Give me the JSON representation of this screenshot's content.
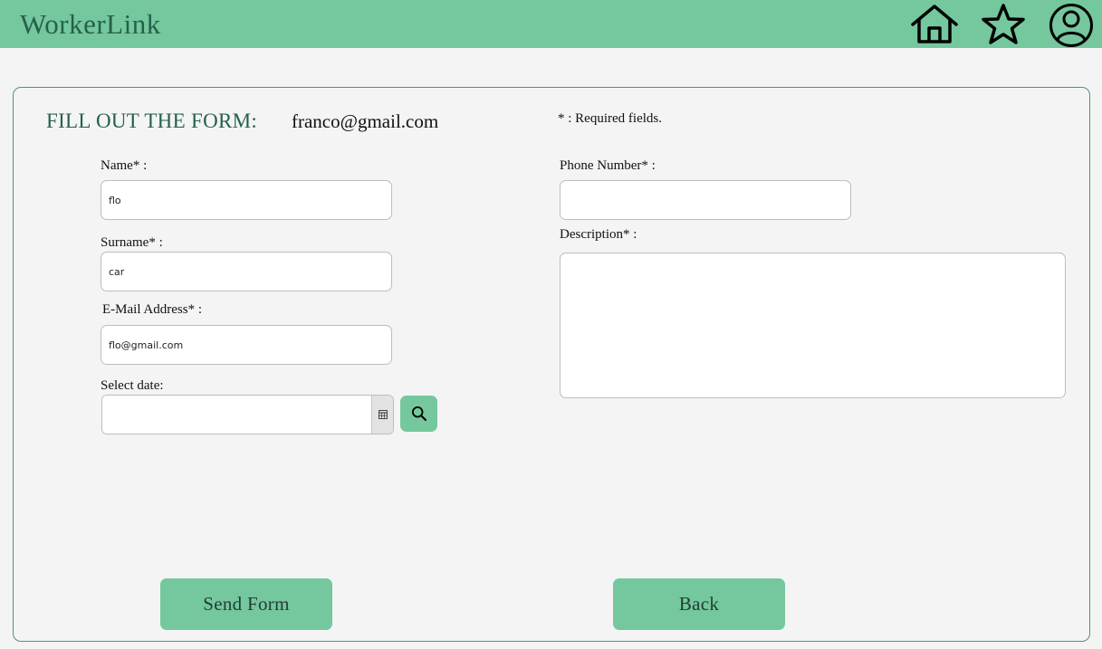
{
  "app": {
    "title": "WorkerLink",
    "icons": [
      "home-icon",
      "star-icon",
      "user-profile-icon"
    ]
  },
  "form": {
    "heading": "FILL OUT THE FORM:",
    "user_email": "franco@gmail.com",
    "required_note": "* : Required fields.",
    "name": {
      "label": "Name* :",
      "value": "flo"
    },
    "surname": {
      "label": "Surname* :",
      "value": "car"
    },
    "email": {
      "label": "E-Mail Address* :",
      "value": "flo@gmail.com"
    },
    "date": {
      "label": "Select date:",
      "value": ""
    },
    "phone": {
      "label": "Phone Number* :",
      "value": ""
    },
    "description": {
      "label": "Description* :",
      "value": ""
    }
  },
  "buttons": {
    "send_label": "Send Form",
    "back_label": "Back"
  },
  "colors": {
    "accent": "#75c79e",
    "heading": "#25614a",
    "border": "#4f9477"
  }
}
